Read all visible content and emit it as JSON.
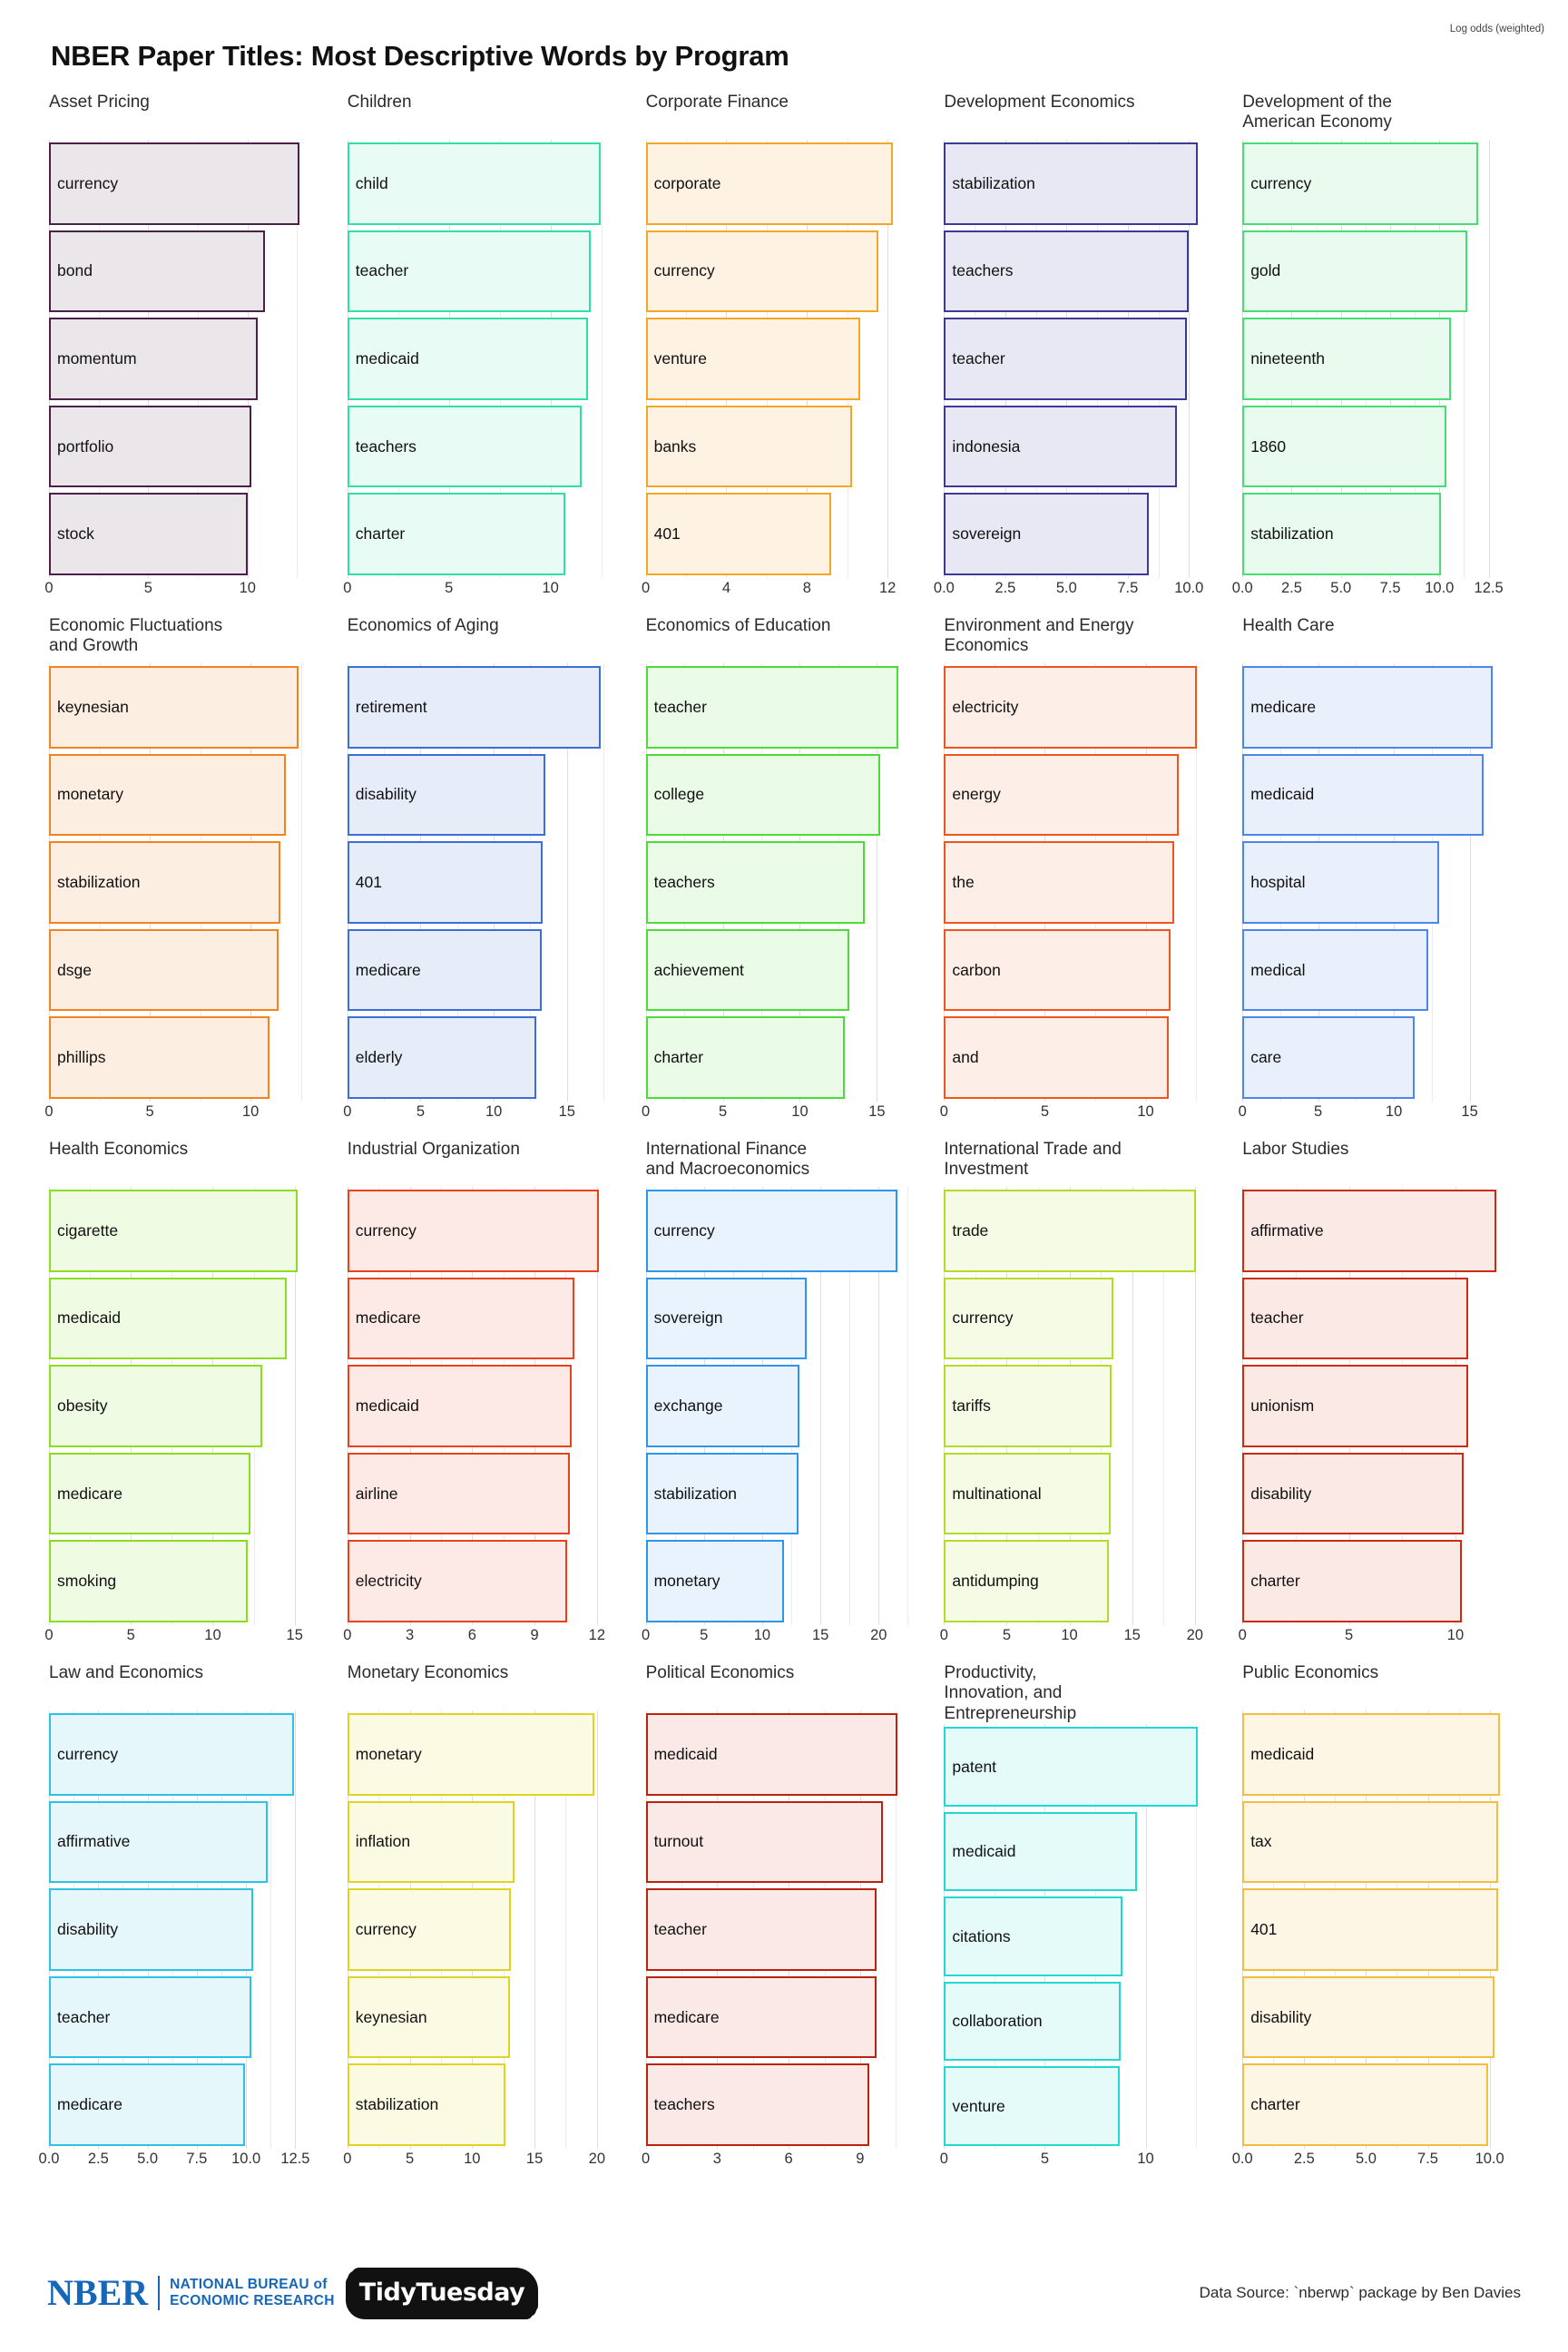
{
  "title": "NBER Paper Titles: Most Descriptive Words by Program",
  "footer": {
    "nber_word": "NBER",
    "nber_sub_line1": "NATIONAL BUREAU of",
    "nber_sub_line2": "ECONOMIC RESEARCH",
    "tidytuesday": "TidyTuesday",
    "data_source": "Data Source: `nberwp` package by Ben Davies",
    "axis_note": "Log odds (weighted)"
  },
  "chart_data": {
    "type": "bar",
    "title": "NBER Paper Titles: Most Descriptive Words by Program",
    "xlabel": "Log odds (weighted)",
    "ylabel": "",
    "orientation": "horizontal",
    "grid": true,
    "legend": "none",
    "facets": [
      {
        "name": "Asset Pricing",
        "color": "#4b2049",
        "fill": "#eae6ea",
        "xlim": [
          0,
          13.2
        ],
        "ticks": [
          0,
          5,
          10
        ],
        "tick_labels": [
          "0",
          "5",
          "10"
        ],
        "categories": [
          "currency",
          "bond",
          "momentum",
          "portfolio",
          "stock"
        ],
        "values": [
          12.6,
          10.9,
          10.5,
          10.2,
          10.0
        ]
      },
      {
        "name": "Children",
        "color": "#2ee0a5",
        "fill": "#e8fbf4",
        "xlim": [
          0,
          12.9
        ],
        "ticks": [
          0,
          5,
          10
        ],
        "tick_labels": [
          "0",
          "5",
          "10"
        ],
        "categories": [
          "child",
          "teacher",
          "medicaid",
          "teachers",
          "charter"
        ],
        "values": [
          12.45,
          12.0,
          11.85,
          11.55,
          10.75
        ]
      },
      {
        "name": "Corporate Finance",
        "color": "#f5a623",
        "fill": "#fef3e2",
        "xlim": [
          0,
          13.0
        ],
        "ticks": [
          0,
          4,
          8,
          12
        ],
        "tick_labels": [
          "0",
          "4",
          "8",
          "12"
        ],
        "categories": [
          "corporate",
          "currency",
          "venture",
          "banks",
          "401"
        ],
        "values": [
          12.25,
          11.55,
          10.65,
          10.25,
          9.2
        ]
      },
      {
        "name": "Development Economics",
        "color": "#3b3b96",
        "fill": "#e7e8f3",
        "xlim": [
          0,
          10.7
        ],
        "ticks": [
          0.0,
          2.5,
          5.0,
          7.5,
          10.0
        ],
        "tick_labels": [
          "0.0",
          "2.5",
          "5.0",
          "7.5",
          "10.0"
        ],
        "categories": [
          "stabilization",
          "teachers",
          "teacher",
          "indonesia",
          "sovereign"
        ],
        "values": [
          10.35,
          10.0,
          9.9,
          9.5,
          8.35
        ]
      },
      {
        "name": "Development of the\nAmerican Economy",
        "color": "#45de73",
        "fill": "#e9fbee",
        "xlim": [
          0,
          13.3
        ],
        "ticks": [
          0.0,
          2.5,
          5.0,
          7.5,
          10.0,
          12.5
        ],
        "tick_labels": [
          "0.0",
          "2.5",
          "5.0",
          "7.5",
          "10.0",
          "12.5"
        ],
        "categories": [
          "currency",
          "gold",
          "nineteenth",
          "1860",
          "stabilization"
        ],
        "values": [
          11.95,
          11.4,
          10.6,
          10.35,
          10.1
        ]
      },
      {
        "name": "Economic Fluctuations\nand Growth",
        "color": "#f58220",
        "fill": "#fdeee2",
        "xlim": [
          0,
          13.0
        ],
        "ticks": [
          0,
          5,
          10
        ],
        "tick_labels": [
          "0",
          "5",
          "10"
        ],
        "categories": [
          "keynesian",
          "monetary",
          "stabilization",
          "dsge",
          "phillips"
        ],
        "values": [
          12.4,
          11.75,
          11.5,
          11.4,
          10.95
        ]
      },
      {
        "name": "Economics of Aging",
        "color": "#3b6fd4",
        "fill": "#e7ecf9",
        "xlim": [
          0,
          17.9
        ],
        "ticks": [
          0,
          5,
          10,
          15
        ],
        "tick_labels": [
          "0",
          "5",
          "10",
          "15"
        ],
        "categories": [
          "retirement",
          "disability",
          "401",
          "medicare",
          "elderly"
        ],
        "values": [
          17.3,
          13.5,
          13.35,
          13.25,
          12.9
        ]
      },
      {
        "name": "Economics of Education",
        "color": "#4ddb3a",
        "fill": "#eafbe7",
        "xlim": [
          0,
          17.0
        ],
        "ticks": [
          0,
          5,
          10,
          15
        ],
        "tick_labels": [
          "0",
          "5",
          "10",
          "15"
        ],
        "categories": [
          "teacher",
          "college",
          "teachers",
          "achievement",
          "charter"
        ],
        "values": [
          16.4,
          15.2,
          14.2,
          13.2,
          12.9
        ]
      },
      {
        "name": "Environment and Energy\nEconomics",
        "color": "#f0541f",
        "fill": "#fdeee7",
        "xlim": [
          0,
          13.0
        ],
        "ticks": [
          0,
          5,
          10
        ],
        "tick_labels": [
          "0",
          "5",
          "10"
        ],
        "categories": [
          "electricity",
          "energy",
          "the",
          "carbon",
          "and"
        ],
        "values": [
          12.55,
          11.65,
          11.4,
          11.25,
          11.15
        ]
      },
      {
        "name": "Health Care",
        "color": "#4c86e8",
        "fill": "#e9f0fc",
        "xlim": [
          0,
          17.3
        ],
        "ticks": [
          0,
          5,
          10,
          15
        ],
        "tick_labels": [
          "0",
          "5",
          "10",
          "15"
        ],
        "categories": [
          "medicare",
          "medicaid",
          "hospital",
          "medical",
          "care"
        ],
        "values": [
          16.55,
          15.9,
          13.0,
          12.25,
          11.4
        ]
      },
      {
        "name": "Health Economics",
        "color": "#8ade1f",
        "fill": "#f0fbe4",
        "xlim": [
          0,
          16.0
        ],
        "ticks": [
          0,
          5,
          10,
          15
        ],
        "tick_labels": [
          "0",
          "5",
          "10",
          "15"
        ],
        "categories": [
          "cigarette",
          "medicaid",
          "obesity",
          "medicare",
          "smoking"
        ],
        "values": [
          15.2,
          14.5,
          13.0,
          12.3,
          12.15
        ]
      },
      {
        "name": "Industrial Organization",
        "color": "#e8411c",
        "fill": "#fdeae6",
        "xlim": [
          0,
          12.6
        ],
        "ticks": [
          0,
          3,
          6,
          9,
          12
        ],
        "tick_labels": [
          "0",
          "3",
          "6",
          "9",
          "12"
        ],
        "categories": [
          "currency",
          "medicare",
          "medicaid",
          "airline",
          "electricity"
        ],
        "values": [
          12.1,
          10.9,
          10.8,
          10.7,
          10.55
        ]
      },
      {
        "name": "International Finance\nand Macroeconomics",
        "color": "#2e95e8",
        "fill": "#e8f3fd",
        "xlim": [
          0,
          22.5
        ],
        "ticks": [
          0,
          5,
          10,
          15,
          20
        ],
        "tick_labels": [
          "0",
          "5",
          "10",
          "15",
          "20"
        ],
        "categories": [
          "currency",
          "sovereign",
          "exchange",
          "stabilization",
          "monetary"
        ],
        "values": [
          21.6,
          13.8,
          13.2,
          13.1,
          11.9
        ]
      },
      {
        "name": "International Trade and\nInvestment",
        "color": "#b2dd26",
        "fill": "#f5fbe5",
        "xlim": [
          0,
          20.9
        ],
        "ticks": [
          0,
          5,
          10,
          15,
          20
        ],
        "tick_labels": [
          "0",
          "5",
          "10",
          "15",
          "20"
        ],
        "categories": [
          "trade",
          "currency",
          "tariffs",
          "multinational",
          "antidumping"
        ],
        "values": [
          20.1,
          13.5,
          13.35,
          13.3,
          13.15
        ]
      },
      {
        "name": "Labor Studies",
        "color": "#cc2b10",
        "fill": "#fbe9e5",
        "xlim": [
          0,
          12.3
        ],
        "ticks": [
          0,
          5,
          10
        ],
        "tick_labels": [
          "0",
          "5",
          "10"
        ],
        "categories": [
          "affirmative",
          "teacher",
          "unionism",
          "disability",
          "charter"
        ],
        "values": [
          11.9,
          10.6,
          10.6,
          10.4,
          10.3
        ]
      },
      {
        "name": "Law and Economics",
        "color": "#2ec1e8",
        "fill": "#e6f7fc",
        "xlim": [
          0,
          13.3
        ],
        "ticks": [
          0.0,
          2.5,
          5.0,
          7.5,
          10.0,
          12.5
        ],
        "tick_labels": [
          "0.0",
          "2.5",
          "5.0",
          "7.5",
          "10.0",
          "12.5"
        ],
        "categories": [
          "currency",
          "affirmative",
          "disability",
          "teacher",
          "medicare"
        ],
        "values": [
          12.45,
          11.1,
          10.35,
          10.25,
          9.95
        ]
      },
      {
        "name": "Monetary Economics",
        "color": "#e0d422",
        "fill": "#fbfae2",
        "xlim": [
          0,
          21.0
        ],
        "ticks": [
          0,
          5,
          10,
          15,
          20
        ],
        "tick_labels": [
          "0",
          "5",
          "10",
          "15",
          "20"
        ],
        "categories": [
          "monetary",
          "inflation",
          "currency",
          "keynesian",
          "stabilization"
        ],
        "values": [
          19.8,
          13.4,
          13.1,
          13.0,
          12.7
        ]
      },
      {
        "name": "Political Economics",
        "color": "#b8250e",
        "fill": "#fae9e6",
        "xlim": [
          0,
          11.0
        ],
        "ticks": [
          0,
          3,
          6,
          9
        ],
        "tick_labels": [
          "0",
          "3",
          "6",
          "9"
        ],
        "categories": [
          "medicaid",
          "turnout",
          "teacher",
          "medicare",
          "teachers"
        ],
        "values": [
          10.55,
          9.95,
          9.7,
          9.7,
          9.4
        ]
      },
      {
        "name": "Productivity,\nInnovation, and\nEntrepreneurship",
        "color": "#21d9d2",
        "fill": "#e5fbfa",
        "xlim": [
          0,
          13.0
        ],
        "ticks": [
          0,
          5,
          10
        ],
        "tick_labels": [
          "0",
          "5",
          "10"
        ],
        "categories": [
          "patent",
          "medicaid",
          "citations",
          "collaboration",
          "venture"
        ],
        "values": [
          12.6,
          9.55,
          8.85,
          8.75,
          8.7
        ]
      },
      {
        "name": "Public Economics",
        "color": "#f3bd3f",
        "fill": "#fef6e4",
        "xlim": [
          0,
          10.6
        ],
        "ticks": [
          0.0,
          2.5,
          5.0,
          7.5,
          10.0
        ],
        "tick_labels": [
          "0.0",
          "2.5",
          "5.0",
          "7.5",
          "10.0"
        ],
        "categories": [
          "medicaid",
          "tax",
          "401",
          "disability",
          "charter"
        ],
        "values": [
          10.4,
          10.35,
          10.35,
          10.2,
          9.95
        ]
      }
    ]
  }
}
